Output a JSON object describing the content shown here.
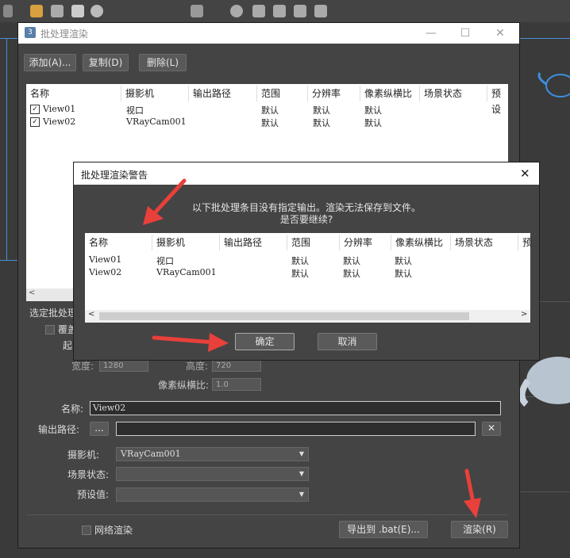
{
  "main_window": {
    "title": "批处理渲染",
    "buttons": {
      "add": "添加(A)...",
      "copy": "复制(D)",
      "delete": "删除(L)"
    },
    "columns": [
      "名称",
      "摄影机",
      "输出路径",
      "范围",
      "分辨率",
      "像素纵横比",
      "场景状态",
      "预设"
    ],
    "rows": [
      {
        "checked": true,
        "name": "View01",
        "camera": "视口",
        "output": "",
        "range": "默认",
        "resolution": "默认",
        "aspect": "默认"
      },
      {
        "checked": true,
        "name": "View02",
        "camera": "VRayCam001",
        "output": "",
        "range": "默认",
        "resolution": "默认",
        "aspect": "默认"
      }
    ],
    "selected_section_label": "选定批处理",
    "override_label": "覆盖",
    "start_label": "起",
    "width_label": "宽度:",
    "width_value": "1280",
    "height_label": "高度:",
    "height_value": "720",
    "pixel_aspect_label": "像素纵横比:",
    "pixel_aspect_value": "1.0",
    "name_label": "名称:",
    "name_value": "View02",
    "output_path_label": "输出路径:",
    "browse_label": "...",
    "camera_label": "摄影机:",
    "camera_value": "VRayCam001",
    "scene_state_label": "场景状态:",
    "preset_label": "预设值:",
    "network_render_label": "网络渲染",
    "export_label": "导出到 .bat(E)...",
    "render_label": "渲染(R)"
  },
  "warning_dialog": {
    "title": "批处理渲染警告",
    "message_line1": "以下批处理条目没有指定输出。渲染无法保存到文件。",
    "message_line2": "是否要继续?",
    "columns": [
      "名称",
      "摄影机",
      "输出路径",
      "范围",
      "分辨率",
      "像素纵横比",
      "场景状态",
      "预"
    ],
    "rows": [
      {
        "name": "View01",
        "camera": "视口",
        "range": "默认",
        "resolution": "默认",
        "aspect": "默认"
      },
      {
        "name": "View02",
        "camera": "VRayCam001",
        "range": "默认",
        "resolution": "默认",
        "aspect": "默认"
      }
    ],
    "ok_label": "确定",
    "cancel_label": "取消"
  },
  "colors": {
    "arrow": "#e8403a",
    "viewport_border": "#4a90d9"
  }
}
